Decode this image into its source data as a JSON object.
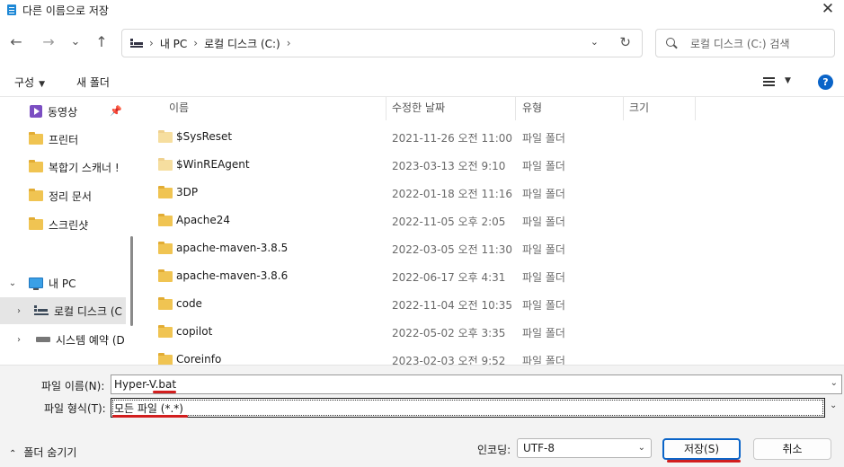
{
  "window": {
    "title": "다른 이름으로 저장",
    "icon": "notepad-icon",
    "close": "✕"
  },
  "nav": {
    "back": "←",
    "forward": "→",
    "recent": "⌄",
    "up": "↑"
  },
  "address": {
    "icon": "this-pc-icon",
    "crumbs": [
      "내 PC",
      "로컬 디스크 (C:)"
    ],
    "sep": "›",
    "dropdown": "⌄",
    "refresh": "↻"
  },
  "search": {
    "placeholder": "로컬 디스크 (C:) 검색"
  },
  "toolbar": {
    "organize": "구성",
    "organize_caret": "▼",
    "new_folder": "새 폴더",
    "view_caret": "▼",
    "help": "?"
  },
  "sidebar": {
    "items": [
      {
        "label": "동영상",
        "icon": "video-icon",
        "pinned": true
      },
      {
        "label": "프린터",
        "icon": "folder-icon"
      },
      {
        "label": "복합기 스캐너 !",
        "icon": "folder-icon"
      },
      {
        "label": "정리 문서",
        "icon": "folder-icon"
      },
      {
        "label": "스크린샷",
        "icon": "folder-icon"
      }
    ],
    "tree": [
      {
        "label": "내 PC",
        "chevron": "⌄",
        "icon": "monitor-icon"
      },
      {
        "label": "로컬 디스크 (C",
        "chevron": "›",
        "icon": "drive-icon",
        "selected": true
      },
      {
        "label": "시스템 예약 (D",
        "chevron": "›",
        "icon": "drive-icon"
      }
    ]
  },
  "columns": {
    "name": "이름",
    "modified": "수정한 날짜",
    "type": "유형",
    "size": "크기",
    "sort_caret": "⌃"
  },
  "files": [
    {
      "name": "$SysReset",
      "date": "2021-11-26 오전 11:00",
      "type": "파일 폴더",
      "hidden": true
    },
    {
      "name": "$WinREAgent",
      "date": "2023-03-13 오전 9:10",
      "type": "파일 폴더",
      "hidden": true
    },
    {
      "name": "3DP",
      "date": "2022-01-18 오전 11:16",
      "type": "파일 폴더"
    },
    {
      "name": "Apache24",
      "date": "2022-11-05 오후 2:05",
      "type": "파일 폴더"
    },
    {
      "name": "apache-maven-3.8.5",
      "date": "2022-03-05 오전 11:30",
      "type": "파일 폴더"
    },
    {
      "name": "apache-maven-3.8.6",
      "date": "2022-06-17 오후 4:31",
      "type": "파일 폴더"
    },
    {
      "name": "code",
      "date": "2022-11-04 오전 10:35",
      "type": "파일 폴더"
    },
    {
      "name": "copilot",
      "date": "2022-05-02 오후 3:35",
      "type": "파일 폴더"
    },
    {
      "name": "Coreinfo",
      "date": "2023-02-03 오전 9:52",
      "type": "파일 폴더"
    }
  ],
  "form": {
    "filename_label": "파일 이름(N):",
    "filename_value": "Hyper-V.bat",
    "filetype_label": "파일 형식(T):",
    "filetype_value": "모든 파일  (*.*)",
    "dropdown": "⌄",
    "hide_folders": "폴더 숨기기",
    "hide_caret": "⌃",
    "encoding_label": "인코딩:",
    "encoding_value": "UTF-8",
    "save": "저장(S)",
    "cancel": "취소"
  },
  "colors": {
    "accent": "#0a64c8",
    "annotation": "#d21e1e",
    "folder": "#f0c452"
  }
}
